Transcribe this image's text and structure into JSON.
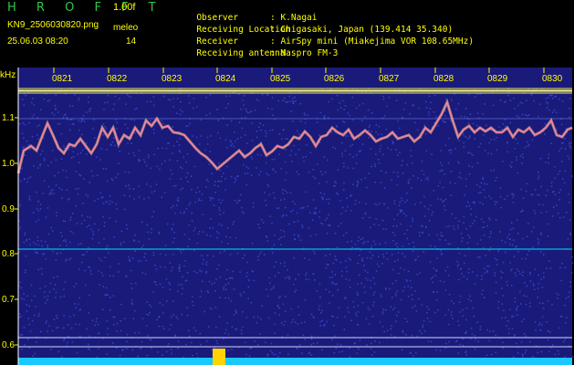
{
  "header": {
    "app_title": "H R O F F T",
    "version": "1.00f",
    "filename": "KN9_2506030820.png",
    "datetime": "25.06.03 08:20",
    "meleo_label": "meleo",
    "meleo_value": "14",
    "info": [
      {
        "label": "Observer",
        "value": ": K.Nagai"
      },
      {
        "label": "Receiving Location",
        "value": ": Chigasaki, Japan (139.414 35.340)"
      },
      {
        "label": "Receiver",
        "value": ": AirSpy mini (Miakejima VOR 108.65MHz)"
      },
      {
        "label": "Receiving antenna",
        "value": ": Maspro FM-3"
      }
    ]
  },
  "axis": {
    "unit": "kHz",
    "y_labels": [
      "1.1",
      "1.0",
      "0.9",
      "0.8",
      "0.7",
      "0.6"
    ],
    "time_labels": [
      "0821",
      "0822",
      "0823",
      "0824",
      "0825",
      "0826",
      "0827",
      "0828",
      "0829",
      "0830"
    ]
  },
  "colors": {
    "label": "#ffff00",
    "title": "#2fc74a",
    "background_noise": "#1a1a7a",
    "trace": "#ff7fae",
    "baseline": "#00e0ff"
  }
}
